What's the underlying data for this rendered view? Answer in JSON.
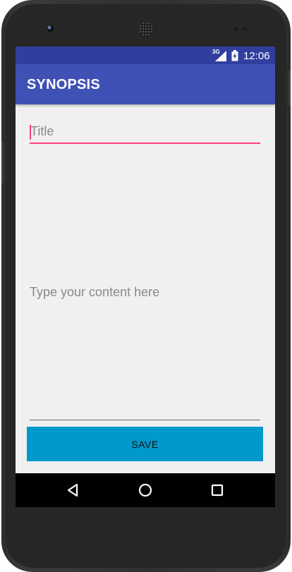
{
  "status_bar": {
    "network_label": "3G",
    "time": "12:06",
    "signal_icon": "cell-signal-icon",
    "battery_icon": "battery-icon"
  },
  "app_bar": {
    "title": "SYNOPSIS"
  },
  "form": {
    "title_placeholder": "Title",
    "title_value": "",
    "content_placeholder": "Type your content here",
    "content_value": "",
    "save_label": "SAVE"
  },
  "nav_bar": {
    "back_icon": "back-triangle-icon",
    "home_icon": "home-circle-icon",
    "recents_icon": "recents-square-icon"
  },
  "colors": {
    "status_bar": "#303f9f",
    "app_bar": "#3f51b5",
    "accent": "#ff4081",
    "save_button": "#0099cc",
    "background": "#f0f0f0"
  }
}
